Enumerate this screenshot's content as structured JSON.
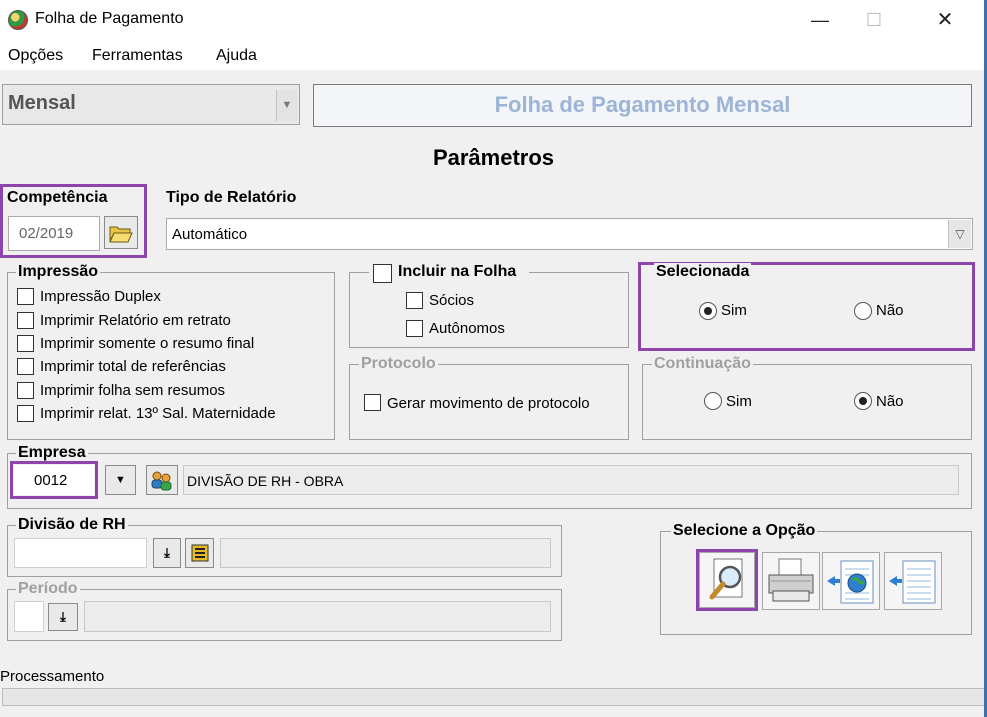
{
  "window": {
    "title": "Folha de Pagamento",
    "minimize": "—",
    "maximize": "☐",
    "close": "✕"
  },
  "menu": {
    "items": [
      "Opções",
      "Ferramentas",
      "Ajuda"
    ]
  },
  "mode_select": {
    "value": "Mensal"
  },
  "header": {
    "title": "Folha de Pagamento Mensal"
  },
  "section_title": "Parâmetros",
  "competencia": {
    "label": "Competência",
    "value": "02/2019"
  },
  "tipo_relatorio": {
    "label": "Tipo de Relatório",
    "value": "Automático"
  },
  "impressao": {
    "legend": "Impressão",
    "options": [
      "Impressão Duplex",
      "Imprimir Relatório em retrato",
      "Imprimir somente o resumo final",
      "Imprimir total de referências",
      "Imprimir folha sem resumos",
      "Imprimir relat. 13º Sal. Maternidade"
    ]
  },
  "incluir": {
    "legend": "Incluir na Folha",
    "options": [
      "Sócios",
      "Autônomos"
    ]
  },
  "protocolo": {
    "legend": "Protocolo",
    "option": "Gerar movimento de protocolo"
  },
  "selecionada": {
    "legend": "Selecionada",
    "sim": "Sim",
    "nao": "Não",
    "selected": "Sim"
  },
  "continuacao": {
    "legend": "Continuação",
    "sim": "Sim",
    "nao": "Não",
    "selected": "Não"
  },
  "empresa": {
    "label": "Empresa",
    "code": "0012",
    "name": "DIVISÃO DE RH - OBRA"
  },
  "divisao": {
    "label": "Divisão de RH"
  },
  "periodo": {
    "label": "Período"
  },
  "opcoes": {
    "label": "Selecione a Opção"
  },
  "status": {
    "label": "Processamento"
  },
  "colors": {
    "highlight": "#8e44ad",
    "header_text": "#9cb4d6"
  }
}
